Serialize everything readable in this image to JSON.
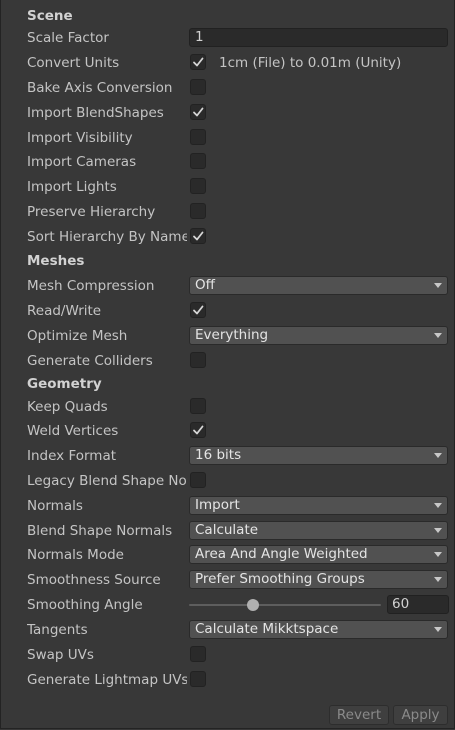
{
  "scene": {
    "header": "Scene",
    "scale_factor_label": "Scale Factor",
    "scale_factor_value": "1",
    "convert_units_label": "Convert Units",
    "convert_units_checked": true,
    "convert_units_desc": "1cm (File) to 0.01m (Unity)",
    "bake_axis_label": "Bake Axis Conversion",
    "bake_axis_checked": false,
    "import_blendshapes_label": "Import BlendShapes",
    "import_blendshapes_checked": true,
    "import_visibility_label": "Import Visibility",
    "import_visibility_checked": false,
    "import_cameras_label": "Import Cameras",
    "import_cameras_checked": false,
    "import_lights_label": "Import Lights",
    "import_lights_checked": false,
    "preserve_hierarchy_label": "Preserve Hierarchy",
    "preserve_hierarchy_checked": false,
    "sort_hierarchy_label": "Sort Hierarchy By Name",
    "sort_hierarchy_checked": true
  },
  "meshes": {
    "header": "Meshes",
    "mesh_compression_label": "Mesh Compression",
    "mesh_compression_value": "Off",
    "read_write_label": "Read/Write",
    "read_write_checked": true,
    "optimize_mesh_label": "Optimize Mesh",
    "optimize_mesh_value": "Everything",
    "generate_colliders_label": "Generate Colliders",
    "generate_colliders_checked": false
  },
  "geometry": {
    "header": "Geometry",
    "keep_quads_label": "Keep Quads",
    "keep_quads_checked": false,
    "weld_vertices_label": "Weld Vertices",
    "weld_vertices_checked": true,
    "index_format_label": "Index Format",
    "index_format_value": "16 bits",
    "legacy_blend_label": "Legacy Blend Shape Normals",
    "legacy_blend_checked": false,
    "normals_label": "Normals",
    "normals_value": "Import",
    "blend_shape_normals_label": "Blend Shape Normals",
    "blend_shape_normals_value": "Calculate",
    "normals_mode_label": "Normals Mode",
    "normals_mode_value": "Area And Angle Weighted",
    "smoothness_source_label": "Smoothness Source",
    "smoothness_source_value": "Prefer Smoothing Groups",
    "smoothing_angle_label": "Smoothing Angle",
    "smoothing_angle_value": "60",
    "smoothing_angle_fraction": 0.3333,
    "tangents_label": "Tangents",
    "tangents_value": "Calculate Mikktspace",
    "swap_uvs_label": "Swap UVs",
    "swap_uvs_checked": false,
    "generate_lightmap_label": "Generate Lightmap UVs",
    "generate_lightmap_checked": false
  },
  "footer": {
    "revert_label": "Revert",
    "apply_label": "Apply"
  },
  "colors": {
    "background": "#383838",
    "field": "#2a2a2a",
    "dropdown": "#515151",
    "text": "#c4c4c4"
  }
}
